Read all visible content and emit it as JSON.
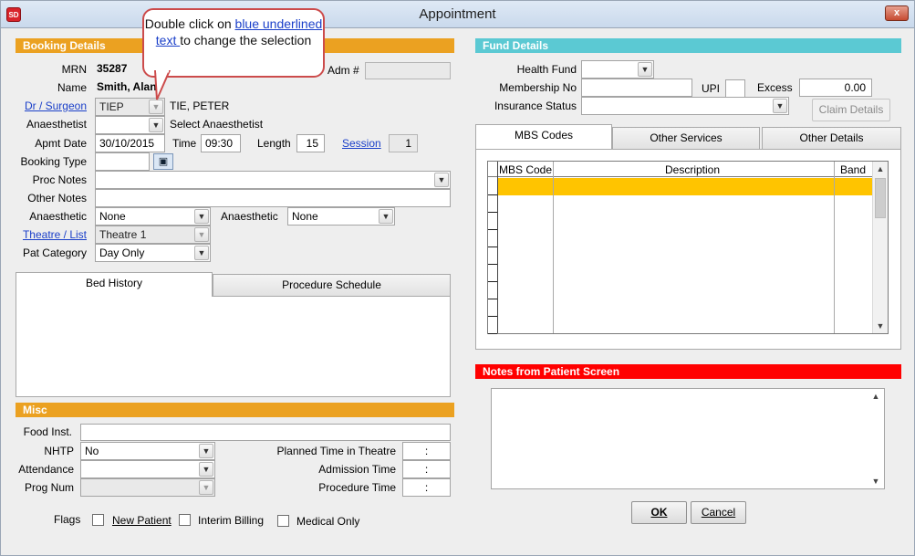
{
  "window": {
    "title": "Appointment",
    "app_icon": "SD",
    "close": "x"
  },
  "callout": {
    "before": "Double click on ",
    "link": "blue underlined text ",
    "after": "to change the selection"
  },
  "booking": {
    "header": "Booking Details",
    "mrn_label": "MRN",
    "mrn_value": "35287",
    "adm_label": "Adm #",
    "adm_value": "",
    "name_label": "Name",
    "name_value": "Smith, Alan",
    "surgeon_label": "Dr / Surgeon",
    "surgeon_code": "TIEP",
    "surgeon_name": "TIE, PETER",
    "anaesthetist_label": "Anaesthetist",
    "anaesthetist_value": "",
    "anaesthetist_hint": "Select Anaesthetist",
    "apmt_date_label": "Apmt Date",
    "apmt_date_value": "30/10/2015",
    "time_label": "Time",
    "time_value": "09:30",
    "length_label": "Length",
    "length_value": "15",
    "session_label": "Session",
    "session_value": "1",
    "booking_type_label": "Booking Type",
    "booking_type_value": "",
    "proc_notes_label": "Proc Notes",
    "proc_notes_value": "",
    "other_notes_label": "Other Notes",
    "other_notes_value": "",
    "anaesthetic_label": "Anaesthetic",
    "anaesthetic_value": "None",
    "anaesthetic2_label": "Anaesthetic",
    "anaesthetic2_value": "None",
    "theatre_label": "Theatre / List",
    "theatre_value": "Theatre 1",
    "pat_category_label": "Pat Category",
    "pat_category_value": "Day Only"
  },
  "history_tabs": [
    {
      "label": "Bed History"
    },
    {
      "label": "Procedure Schedule"
    }
  ],
  "misc": {
    "header": "Misc",
    "food_label": "Food Inst.",
    "food_value": "",
    "nhtp_label": "NHTP",
    "nhtp_value": "No",
    "attendance_label": "Attendance",
    "attendance_value": "",
    "prog_label": "Prog Num",
    "prog_value": "",
    "planned_label": "Planned Time in Theatre",
    "planned_value": ":",
    "admission_label": "Admission Time",
    "admission_value": ":",
    "procedure_label": "Procedure Time",
    "procedure_value": ":",
    "flags_label": "Flags",
    "flag_new_patient": "New Patient",
    "flag_interim": "Interim Billing",
    "flag_medical": "Medical Only"
  },
  "fund": {
    "header": "Fund Details",
    "health_fund_label": "Health Fund",
    "health_fund_value": "",
    "membership_label": "Membership No",
    "membership_value": "",
    "upi_label": "UPI",
    "upi_value": "",
    "excess_label": "Excess",
    "excess_value": "0.00",
    "insurance_label": "Insurance Status",
    "insurance_value": "",
    "claim_button": "Claim Details"
  },
  "mbs_tabs": [
    {
      "label": "MBS Codes"
    },
    {
      "label": "Other Services"
    },
    {
      "label": "Other Details"
    }
  ],
  "mbs_grid": {
    "columns": [
      "MBS Code",
      "Description",
      "Band"
    ]
  },
  "notes": {
    "header": "Notes from Patient Screen",
    "value": ""
  },
  "buttons": {
    "ok": "OK",
    "cancel": "Cancel"
  },
  "colors": {
    "section_orange": "#eba121",
    "section_teal": "#5bc9d3",
    "section_red": "#ff0000",
    "link_blue": "#1a3fc9",
    "grid_selected": "#ffc400"
  }
}
